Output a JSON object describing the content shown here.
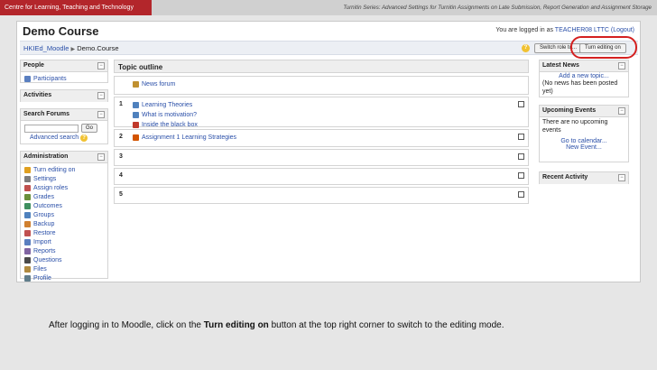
{
  "slide": {
    "header_left": "Centre for Learning, Teaching and Technology",
    "header_right": "Turnitin Series: Advanced Settings for Turnitin Assignments on Late Submission, Report Generation and Assignment Storage",
    "caption_before": "After logging in to Moodle, click on the ",
    "caption_bold": "Turn editing on",
    "caption_after": " button at the top right corner to switch to the editing mode."
  },
  "page": {
    "title": "Demo Course",
    "login_text": "You are logged in as ",
    "login_user": "TEACHER08 LTTC",
    "login_logout": "(Logout)"
  },
  "navbar": {
    "home": "HKIEd_Moodle",
    "separator": "▶",
    "current": "Demo.Course",
    "switch_role": "Switch role to...",
    "turn_editing": "Turn editing on",
    "help": "?"
  },
  "blocks": {
    "people": {
      "title": "People",
      "items": [
        {
          "label": "Participants",
          "icon": "people-icon"
        }
      ]
    },
    "activities": {
      "title": "Activities"
    },
    "search": {
      "title": "Search Forums",
      "go": "Go",
      "advanced": "Advanced search",
      "help": "?"
    },
    "admin": {
      "title": "Administration",
      "items": [
        {
          "label": "Turn editing on",
          "icon": "edit-icon"
        },
        {
          "label": "Settings",
          "icon": "settings-icon"
        },
        {
          "label": "Assign roles",
          "icon": "roles-icon"
        },
        {
          "label": "Grades",
          "icon": "grades-icon"
        },
        {
          "label": "Outcomes",
          "icon": "outcomes-icon"
        },
        {
          "label": "Groups",
          "icon": "groups-icon"
        },
        {
          "label": "Backup",
          "icon": "backup-icon"
        },
        {
          "label": "Restore",
          "icon": "restore-icon"
        },
        {
          "label": "Import",
          "icon": "import-icon"
        },
        {
          "label": "Reports",
          "icon": "reports-icon"
        },
        {
          "label": "Questions",
          "icon": "questions-icon"
        },
        {
          "label": "Files",
          "icon": "files-icon"
        },
        {
          "label": "Profile",
          "icon": "profile-icon"
        }
      ]
    },
    "news": {
      "title": "Latest News",
      "add": "Add a new topic...",
      "empty": "(No news has been posted yet)"
    },
    "events": {
      "title": "Upcoming Events",
      "empty": "There are no upcoming events",
      "calendar": "Go to calendar...",
      "new_event": "New Event..."
    },
    "recent": {
      "title": "Recent Activity"
    }
  },
  "topic_outline": {
    "title": "Topic outline",
    "sections": [
      {
        "num": "",
        "items": [
          {
            "label": "News forum",
            "icon": "forum-icon"
          }
        ]
      },
      {
        "num": "1",
        "items": [
          {
            "label": "Learning Theories",
            "icon": "page-icon"
          },
          {
            "label": "What is motivation?",
            "icon": "page-icon"
          },
          {
            "label": "Inside the black box",
            "icon": "pdf-icon"
          }
        ]
      },
      {
        "num": "2",
        "items": [
          {
            "label": "Assignment 1 Learning Strategies",
            "icon": "assignment-icon"
          }
        ]
      },
      {
        "num": "3",
        "items": []
      },
      {
        "num": "4",
        "items": []
      },
      {
        "num": "5",
        "items": []
      }
    ]
  },
  "colors": {
    "header_accent": "#b3262b",
    "link": "#2a4fa8",
    "highlight_ring": "#d42020"
  }
}
